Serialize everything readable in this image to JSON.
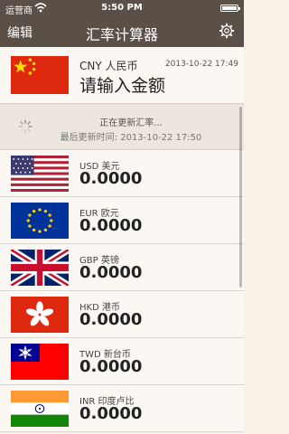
{
  "status": {
    "carrier": "运营商",
    "time": "5:50 PM"
  },
  "nav": {
    "edit_label": "编辑",
    "title": "汇率计算器"
  },
  "base": {
    "code": "CNY 人民币",
    "date": "2013-10-22 17:49",
    "prompt": "请输入金额"
  },
  "updating": {
    "line1": "正在更新汇率...",
    "line2": "最后更新时间: 2013-10-22 17:50"
  },
  "currencies": [
    {
      "code": "USD 美元",
      "value": "0.0000"
    },
    {
      "code": "EUR 欧元",
      "value": "0.0000"
    },
    {
      "code": "GBP 英镑",
      "value": "0.0000"
    },
    {
      "code": "HKD 港币",
      "value": "0.0000"
    },
    {
      "code": "TWD 新台币",
      "value": "0.0000"
    },
    {
      "code": "INR 印度卢比",
      "value": "0.0000"
    }
  ],
  "colors": {
    "bar": "#5a5048",
    "background": "#f7f1e8"
  }
}
